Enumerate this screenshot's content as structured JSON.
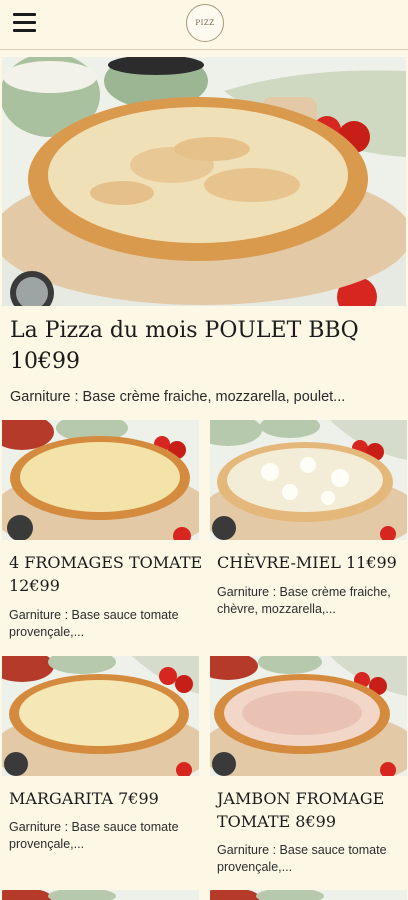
{
  "header": {
    "menu_icon": "hamburger-menu-icon",
    "logo_text": "PIZZ"
  },
  "featured": {
    "title": "La Pizza du mois POULET BBQ 10€99",
    "description": "Garniture : Base crème fraiche, mozzarella, poulet..."
  },
  "products": [
    {
      "title": "4 FROMAGES TOMATE 12€99",
      "description": "Garniture : Base sauce tomate provençale,..."
    },
    {
      "title": "CHÈVRE-MIEL 11€99",
      "description": "Garniture : Base crème fraiche, chèvre, mozzarella,..."
    },
    {
      "title": "MARGARITA 7€99",
      "description": "Garniture : Base sauce tomate provençale,..."
    },
    {
      "title": "JAMBON FROMAGE TOMATE 8€99",
      "description": "Garniture : Base sauce tomate provençale,..."
    }
  ],
  "colors": {
    "background": "#fdf7e6",
    "text": "#1d1d1d",
    "board": "#e2c6a3",
    "crust": "#d89a4e"
  }
}
